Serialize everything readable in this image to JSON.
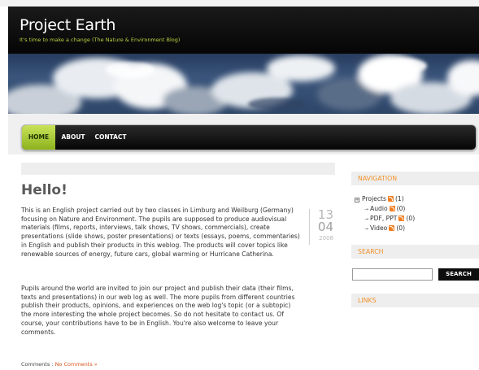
{
  "header": {
    "title": "Project Earth",
    "tagline": "It's time to make a change (The Nature & Environment Blog)"
  },
  "nav": {
    "home": "HOME",
    "about": "ABOUT",
    "contact": "CONTACT"
  },
  "post": {
    "title": "Hello!",
    "paragraph1": "This is an English project carried out by two classes in Limburg and Weilburg (Germany) focusing on Nature and Environment. The pupils are supposed to produce audiovisual materials (films, reports, interviews, talk shows, TV shows, commercials), create presentations (slide shows, poster presentations) or texts (essays, poems, commentaries) in English and publish their products in this weblog. The products will cover topics like renewable sources of energy, future cars, global warming or Hurricane Catherina.",
    "paragraph2": "Pupils around the world are invited to join our project and publish their data (their films, texts and presentations) in our web log as well. The more pupils from different countries publish their products, opinions, and experiences on the web log's topic (or a subtopic) the more interesting the whole project becomes. So do not hesitate to contact us. Of course, your contributions have to be in English. You're also welcome to leave your comments.",
    "date_day": "13",
    "date_month": "04",
    "date_year": "2008",
    "comments_label": "Comments : ",
    "comments_link": "No Comments »"
  },
  "sidebar": {
    "navigation_heading": "NAVIGATION",
    "categories": [
      {
        "label": "Projects",
        "count": "(1)"
      },
      {
        "label": "Audio",
        "count": "(0)"
      },
      {
        "label": "PDF, PPT",
        "count": "(0)"
      },
      {
        "label": "Video",
        "count": "(0)"
      }
    ],
    "search_heading": "SEARCH",
    "search_placeholder": "",
    "search_button": "SEARCH",
    "links_heading": "LINKS"
  },
  "colors": {
    "accent_green": "#8cb21d",
    "tagline": "#b6d442",
    "sidebar_heading": "#f0922c",
    "link": "#d9531e",
    "rss": "#f47f20"
  },
  "icons": [
    "rss-icon",
    "expand-icon",
    "arrow-icon"
  ]
}
